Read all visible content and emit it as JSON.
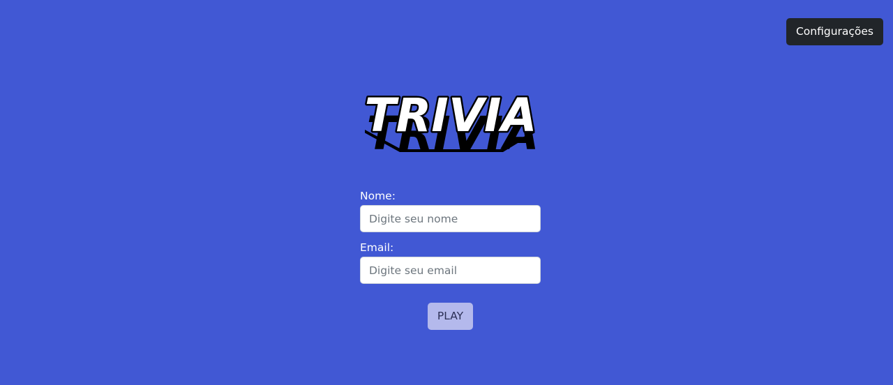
{
  "header": {
    "settings_label": "Configurações"
  },
  "logo": {
    "text": "TRIVIA"
  },
  "form": {
    "name_label": "Nome:",
    "name_placeholder": "Digite seu nome",
    "name_value": "",
    "email_label": "Email:",
    "email_placeholder": "Digite seu email",
    "email_value": ""
  },
  "play": {
    "label": "PLAY"
  },
  "colors": {
    "background": "#4158d4",
    "settings_button": "#212529",
    "play_button": "#b4b9ec"
  }
}
